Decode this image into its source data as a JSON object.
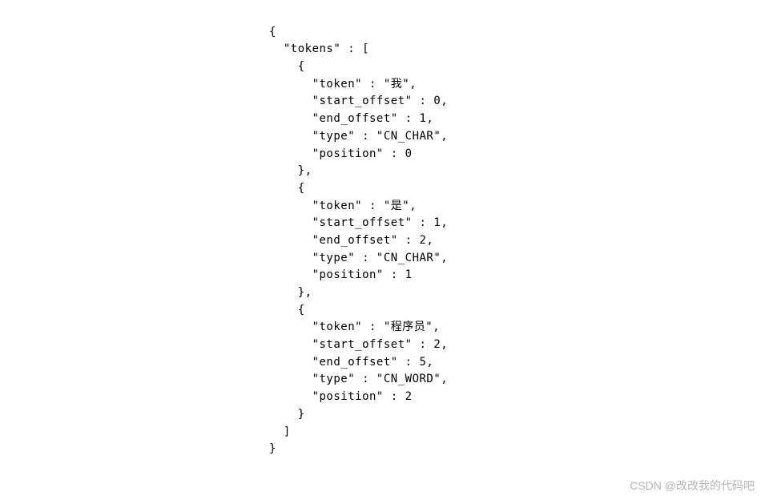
{
  "code": {
    "line1": "{",
    "line2": "  \"tokens\" : [",
    "line3": "    {",
    "line4": "      \"token\" : \"我\",",
    "line5": "      \"start_offset\" : 0,",
    "line6": "      \"end_offset\" : 1,",
    "line7": "      \"type\" : \"CN_CHAR\",",
    "line8": "      \"position\" : 0",
    "line9": "    },",
    "line10": "    {",
    "line11": "      \"token\" : \"是\",",
    "line12": "      \"start_offset\" : 1,",
    "line13": "      \"end_offset\" : 2,",
    "line14": "      \"type\" : \"CN_CHAR\",",
    "line15": "      \"position\" : 1",
    "line16": "    },",
    "line17": "    {",
    "line18": "      \"token\" : \"程序员\",",
    "line19": "      \"start_offset\" : 2,",
    "line20": "      \"end_offset\" : 5,",
    "line21": "      \"type\" : \"CN_WORD\",",
    "line22": "      \"position\" : 2",
    "line23": "    }",
    "line24": "  ]",
    "line25": "}"
  },
  "watermark": "CSDN @改改我的代码吧",
  "partial": ""
}
